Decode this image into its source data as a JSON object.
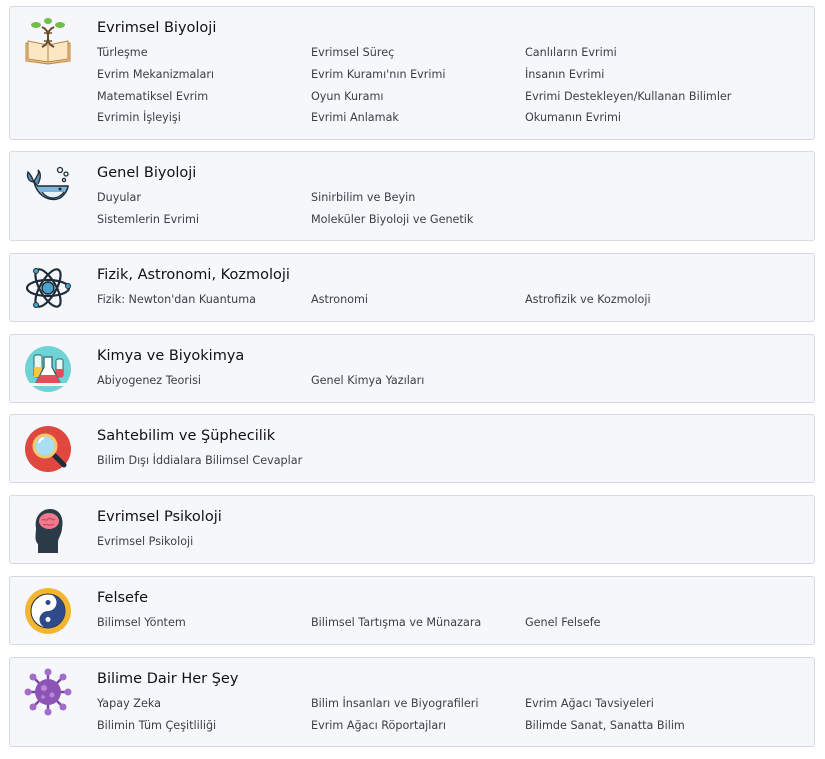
{
  "categories": [
    {
      "title": "Evrimsel Biyoloji",
      "icon": "evolution-book-icon",
      "links": [
        "Türleşme",
        "Evrimsel Süreç",
        "Canlıların Evrimi",
        "Evrim Mekanizmaları",
        "Evrim Kuramı'nın Evrimi",
        "İnsanın Evrimi",
        "Matematiksel Evrim",
        "Oyun Kuramı",
        "Evrimi Destekleyen/Kullanan Bilimler",
        "Evrimin İşleyişi",
        "Evrimi Anlamak",
        "Okumanın Evrimi"
      ]
    },
    {
      "title": "Genel Biyoloji",
      "icon": "whale-icon",
      "links": [
        "Duyular",
        "Sinirbilim ve Beyin",
        "Sistemlerin Evrimi",
        "Moleküler Biyoloji ve Genetik"
      ]
    },
    {
      "title": "Fizik, Astronomi, Kozmoloji",
      "icon": "atom-icon",
      "links": [
        "Fizik: Newton'dan Kuantuma",
        "Astronomi",
        "Astrofizik ve Kozmoloji"
      ]
    },
    {
      "title": "Kimya ve Biyokimya",
      "icon": "chemistry-flask-icon",
      "links": [
        "Abiyogenez Teorisi",
        "Genel Kimya Yazıları"
      ]
    },
    {
      "title": "Sahtebilim ve Şüphecilik",
      "icon": "magnifier-icon",
      "links": [
        "Bilim Dışı İddialara Bilimsel Cevaplar"
      ]
    },
    {
      "title": "Evrimsel Psikoloji",
      "icon": "head-brain-icon",
      "links": [
        "Evrimsel Psikoloji"
      ]
    },
    {
      "title": "Felsefe",
      "icon": "yin-yang-icon",
      "links": [
        "Bilimsel Yöntem",
        "Bilimsel Tartışma ve Münazara",
        "Genel Felsefe"
      ]
    },
    {
      "title": "Bilime Dair Her Şey",
      "icon": "virus-icon",
      "links": [
        "Yapay Zeka",
        "Bilim İnsanları ve Biyografileri",
        "Evrim Ağacı Tavsiyeleri",
        "Bilimin Tüm Çeşitliliği",
        "Evrim Ağacı Röportajları",
        "Bilimde Sanat, Sanatta Bilim"
      ]
    }
  ]
}
